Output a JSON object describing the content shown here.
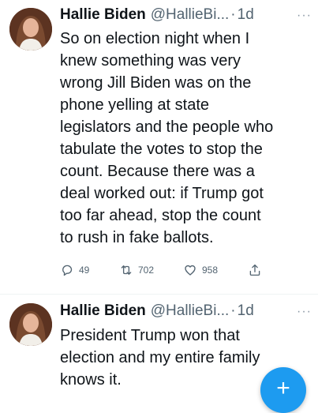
{
  "tweets": [
    {
      "author_name": "Hallie Biden",
      "handle": "@HallieBi...",
      "separator": "·",
      "time": "1d",
      "more_icon": "ellipsis-icon",
      "more_glyph": "···",
      "text": "So on election night when I\nknew something was very\nwrong Jill Biden was on the\nphone yelling at state\nlegislators and the people who\ntabulate the votes to stop the\ncount. Because there was a\ndeal worked out: if Trump got\ntoo far ahead, stop the count\nto rush in fake ballots.",
      "actions": {
        "reply": {
          "icon": "reply-icon",
          "count": "49"
        },
        "retweet": {
          "icon": "retweet-icon",
          "count": "702"
        },
        "like": {
          "icon": "heart-icon",
          "count": "958"
        },
        "share": {
          "icon": "share-icon"
        }
      }
    },
    {
      "author_name": "Hallie Biden",
      "handle": "@HallieBi...",
      "separator": "·",
      "time": "1d",
      "more_icon": "ellipsis-icon",
      "more_glyph": "···",
      "text": "President Trump won that\nelection and my entire family\nknows it."
    }
  ],
  "compose_button": {
    "icon": "plus-icon",
    "glyph": "+",
    "color": "#1d9bf0"
  },
  "colors": {
    "text": "#0f1419",
    "secondary": "#536471",
    "accent": "#1d9bf0"
  }
}
